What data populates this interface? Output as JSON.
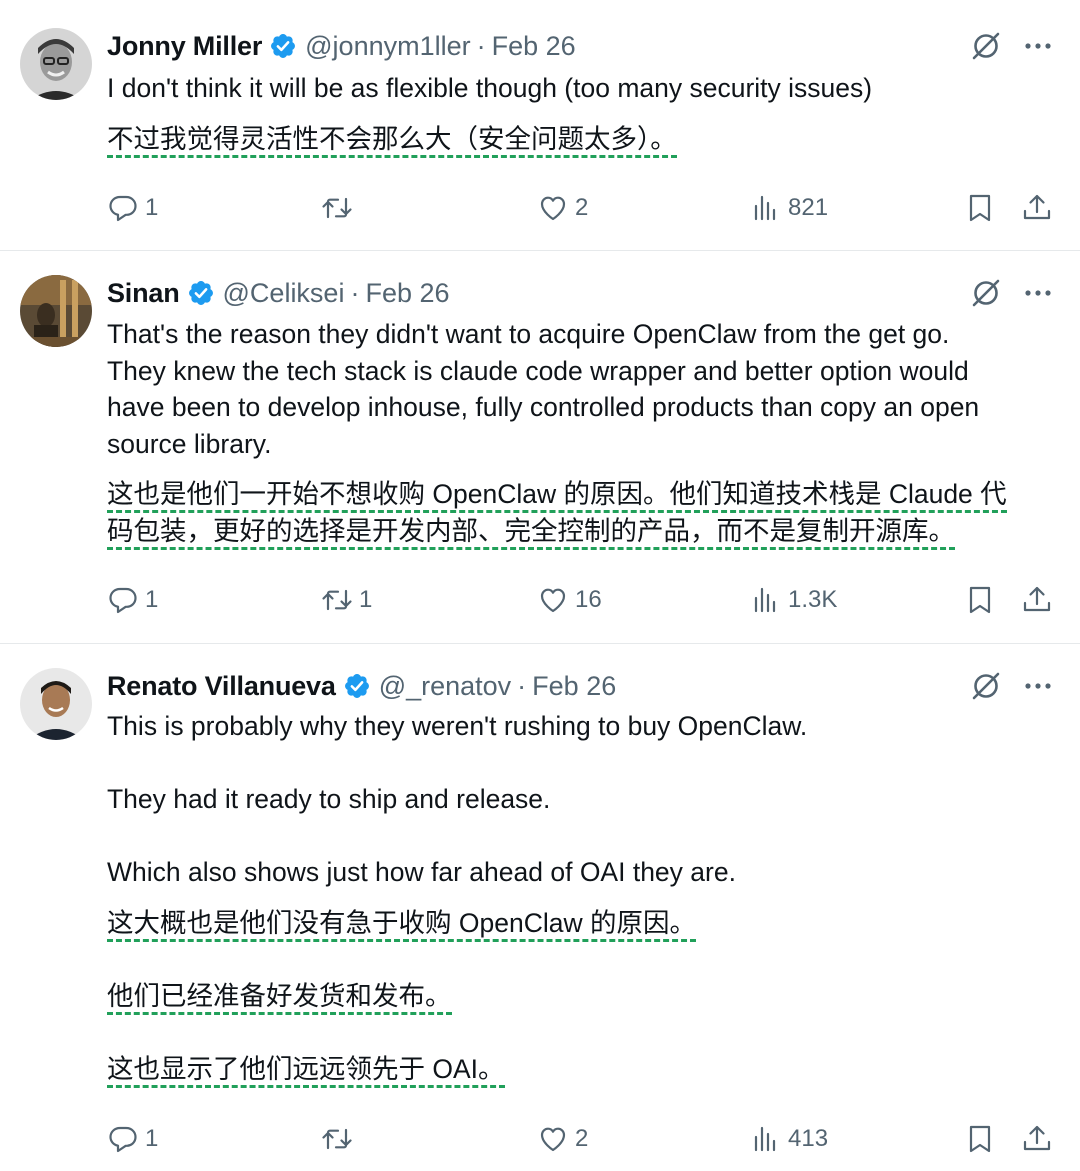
{
  "tweets": [
    {
      "name": "Jonny Miller",
      "handle": "@jonnym1ller",
      "separator": "·",
      "date": "Feb 26",
      "text_lines": [
        "I don't think it will be as flexible though (too many security issues)"
      ],
      "translation_lines": [
        "不过我觉得灵活性不会那么大（安全问题太多）。"
      ],
      "replies": "1",
      "reposts": "",
      "likes": "2",
      "views": "821"
    },
    {
      "name": "Sinan",
      "handle": "@Celiksei",
      "separator": "·",
      "date": "Feb 26",
      "text_lines": [
        "That's the reason they didn't want to acquire OpenClaw from the get go.",
        "They knew the tech stack is claude code wrapper and better option would",
        "have been to develop inhouse, fully controlled products than copy an open",
        "source library."
      ],
      "translation_lines": [
        "这也是他们一开始不想收购 OpenClaw 的原因。他们知道技术栈是 Claude 代",
        "码包装，更好的选择是开发内部、完全控制的产品，而不是复制开源库。"
      ],
      "replies": "1",
      "reposts": "1",
      "likes": "16",
      "views": "1.3K"
    },
    {
      "name": "Renato Villanueva",
      "handle": "@_renatov",
      "separator": "·",
      "date": "Feb 26",
      "text_lines": [
        "This is probably why they weren't rushing to buy OpenClaw.",
        "They had it ready to ship and release.",
        "Which also shows just how far ahead of OAI they are."
      ],
      "translation_lines": [
        "这大概也是他们没有急于收购 OpenClaw 的原因。",
        "他们已经准备好发货和发布。",
        "这也显示了他们远远领先于 OAI。"
      ],
      "replies": "1",
      "reposts": "",
      "likes": "2",
      "views": "413"
    }
  ],
  "colors": {
    "text": "#0f1419",
    "muted": "#536471",
    "verified": "#1d9bf0",
    "translation_underline": "#21a05a",
    "divider": "#e6e9eb"
  },
  "icons": [
    "verified-badge-icon",
    "grok-icon",
    "more-icon",
    "reply-icon",
    "repost-icon",
    "like-icon",
    "views-icon",
    "bookmark-icon",
    "share-icon"
  ]
}
